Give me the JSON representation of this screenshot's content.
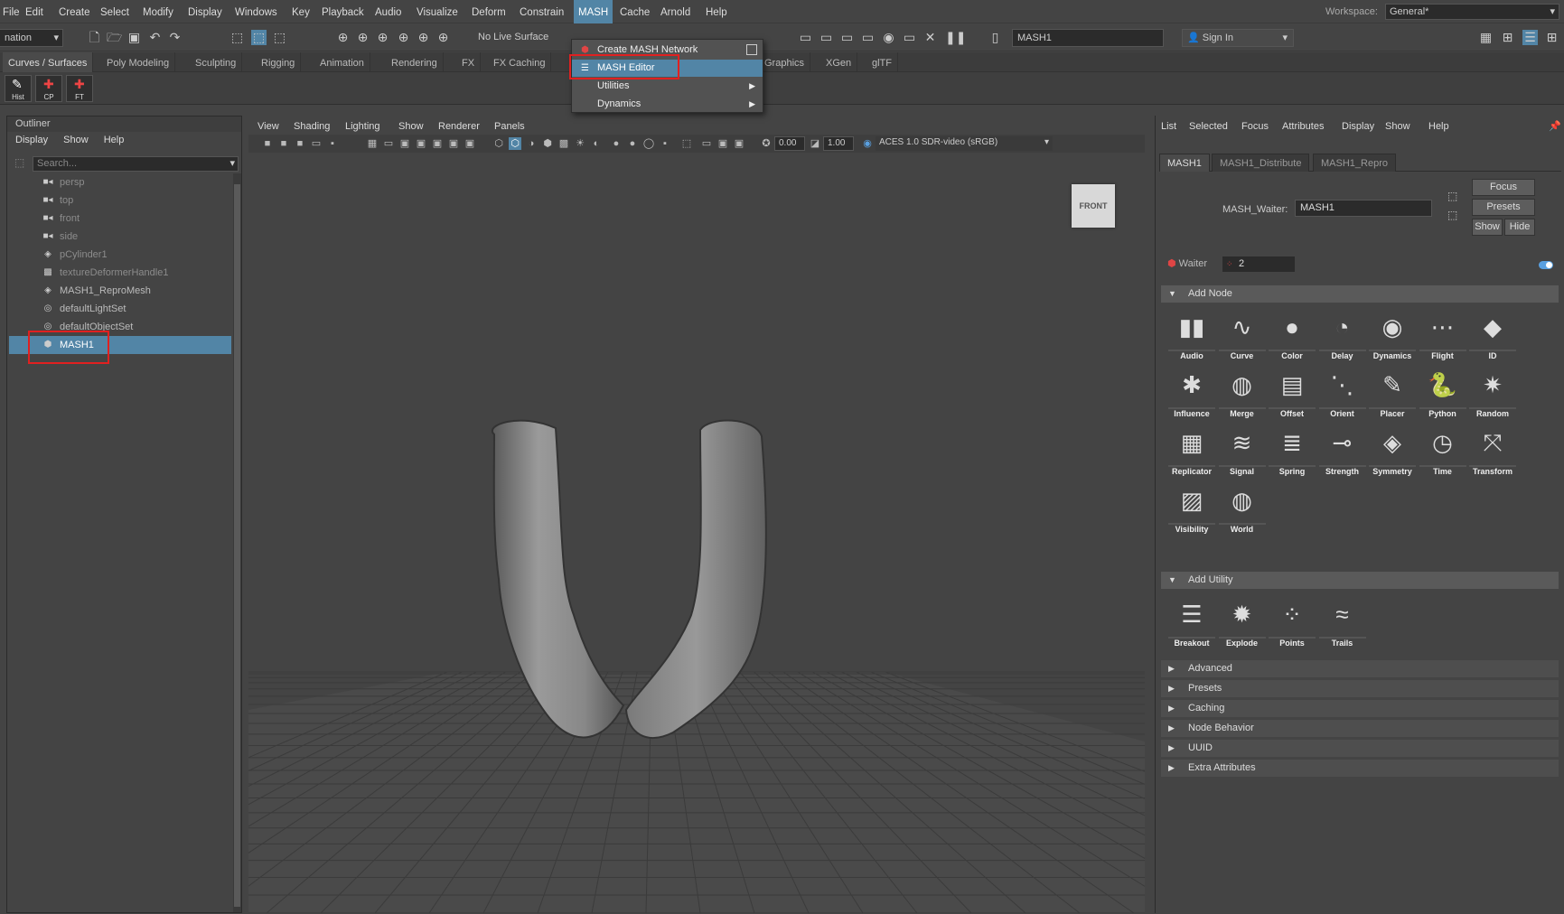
{
  "menubar": {
    "items": [
      "File",
      "Edit",
      "Create",
      "Select",
      "Modify",
      "Display",
      "Windows",
      "Key",
      "Playback",
      "Audio",
      "Visualize",
      "Deform",
      "Constrain",
      "MASH",
      "Cache",
      "Arnold",
      "Help"
    ],
    "active": "MASH",
    "workspace_label": "Workspace:",
    "workspace_value": "General*"
  },
  "toolbar": {
    "mode_value": "nation",
    "live_surface": "No Live Surface",
    "object_field": "MASH1",
    "sign_in": "Sign In"
  },
  "shelf": {
    "tabs": [
      "Curves / Surfaces",
      "Poly Modeling",
      "Sculpting",
      "Rigging",
      "Animation",
      "Rendering",
      "FX",
      "FX Caching",
      "Graphics",
      "XGen",
      "glTF"
    ],
    "buttons": [
      "Hist",
      "CP",
      "FT"
    ]
  },
  "mash_menu": {
    "items": [
      {
        "label": "Create MASH Network"
      },
      {
        "label": "MASH Editor"
      },
      {
        "label": "Utilities"
      },
      {
        "label": "Dynamics"
      }
    ]
  },
  "outliner": {
    "title": "Outliner",
    "menu": [
      "Display",
      "Show",
      "Help"
    ],
    "search_placeholder": "Search...",
    "items": [
      {
        "label": "persp",
        "icon": "camera-icon"
      },
      {
        "label": "top",
        "icon": "camera-icon"
      },
      {
        "label": "front",
        "icon": "camera-icon"
      },
      {
        "label": "side",
        "icon": "camera-icon"
      },
      {
        "label": "pCylinder1",
        "icon": "mesh-icon"
      },
      {
        "label": "textureDeformerHandle1",
        "icon": "deformer-icon"
      },
      {
        "label": "MASH1_ReproMesh",
        "icon": "mesh-icon"
      },
      {
        "label": "defaultLightSet",
        "icon": "set-icon"
      },
      {
        "label": "defaultObjectSet",
        "icon": "set-icon"
      },
      {
        "label": "MASH1",
        "icon": "mash-icon"
      }
    ],
    "selected": "MASH1"
  },
  "viewport": {
    "menu": [
      "View",
      "Shading",
      "Lighting",
      "Show",
      "Renderer",
      "Panels"
    ],
    "exposure": "0.00",
    "gamma": "1.00",
    "color_space": "ACES 1.0 SDR-video (sRGB)",
    "view_cube": "FRONT"
  },
  "attribute_editor": {
    "menu": [
      "List",
      "Selected",
      "Focus",
      "Attributes",
      "Display",
      "Show",
      "Help"
    ],
    "tabs": [
      "MASH1",
      "MASH1_Distribute",
      "MASH1_Repro"
    ],
    "field_label": "MASH_Waiter:",
    "field_value": "MASH1",
    "buttons": {
      "focus": "Focus",
      "presets": "Presets",
      "show": "Show",
      "hide": "Hide"
    },
    "waiter_label": "Waiter",
    "waiter_value": "2",
    "add_node_title": "Add Node",
    "nodes": [
      "Audio",
      "Curve",
      "Color",
      "Delay",
      "Dynamics",
      "Flight",
      "ID",
      "Influence",
      "Merge",
      "Offset",
      "Orient",
      "Placer",
      "Python",
      "Random",
      "Replicator",
      "Signal",
      "Spring",
      "Strength",
      "Symmetry",
      "Time",
      "Transform",
      "Visibility",
      "World"
    ],
    "add_utility_title": "Add Utility",
    "utilities": [
      "Breakout",
      "Explode",
      "Points",
      "Trails"
    ],
    "collapsed_sections": [
      "Advanced",
      "Presets",
      "Caching",
      "Node Behavior",
      "UUID",
      "Extra Attributes"
    ]
  }
}
